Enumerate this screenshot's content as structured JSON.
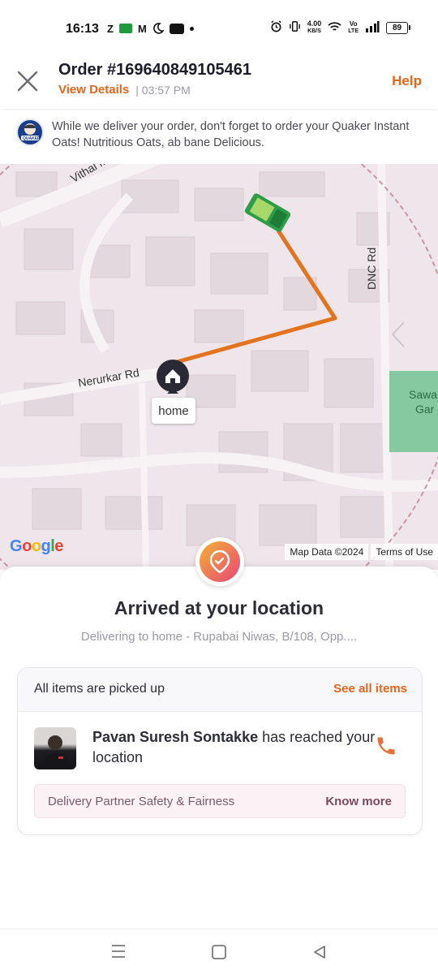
{
  "status_bar": {
    "time": "16:13",
    "left_icons": [
      "Z",
      "sms-icon",
      "M",
      "moon-icon",
      "paytm-icon",
      "dot"
    ],
    "net_speed_value": "4.00",
    "net_speed_unit": "KB/S",
    "volte_top": "Vo",
    "volte_bottom": "LTE",
    "battery": "89"
  },
  "header": {
    "order_title": "Order #169640849105461",
    "view_details": "View Details",
    "time_sep": "| 03:57 PM",
    "help": "Help"
  },
  "banner": {
    "text": "While we deliver your order, don't forget to order your Quaker Instant Oats! Nutritious Oats, ab bane Delicious.",
    "logo_text": "QUAKER"
  },
  "map": {
    "roads": [
      "Vithal M",
      "Nerurkar Rd",
      "DNC Rd"
    ],
    "place_partial_1": "Sawa",
    "place_partial_2": "Gar",
    "home_tag": "home",
    "google": [
      "G",
      "o",
      "o",
      "g",
      "l",
      "e"
    ],
    "google_colors": [
      "#4285f4",
      "#ea4335",
      "#fbbc05",
      "#4285f4",
      "#34a853",
      "#ea4335"
    ],
    "map_data": "Map Data ©2024",
    "terms": "Terms of Use",
    "route_color": "#e2731f"
  },
  "sheet": {
    "title": "Arrived at your location",
    "delivering_to": "Delivering to home - Rupabai Niwas, B/108, Opp....",
    "card": {
      "picked_up": "All items are picked up",
      "see_all": "See all items",
      "partner_name": "Pavan Suresh Sontakke",
      "partner_status": "has reached your location",
      "safety": "Delivery Partner Safety & Fairness",
      "know_more": "Know more"
    }
  },
  "colors": {
    "accent": "#e2661b",
    "map_bg": "#eee6ea"
  }
}
